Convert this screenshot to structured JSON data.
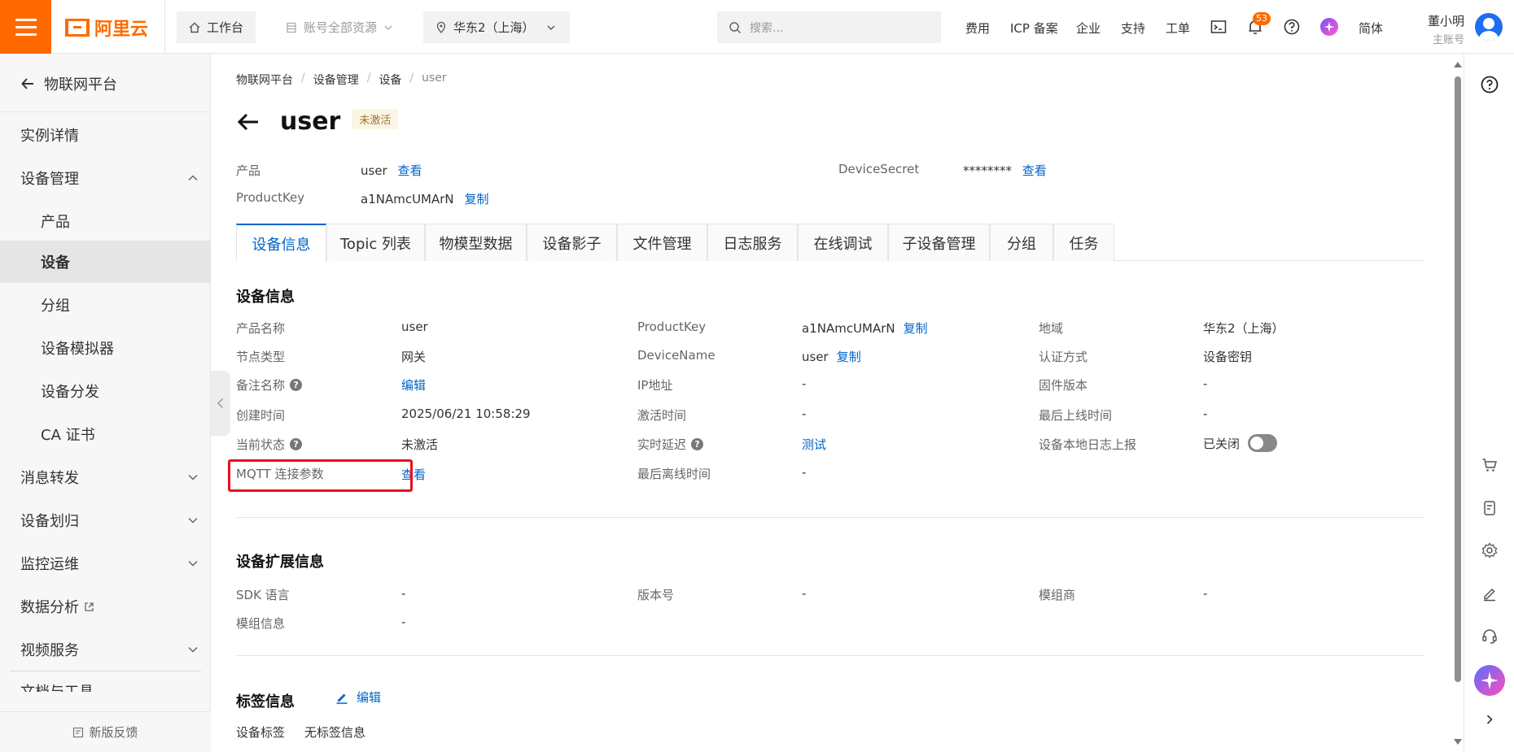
{
  "topbar": {
    "logo_text": "阿里云",
    "workbench": "工作台",
    "resources": "账号全部资源",
    "region": "华东2（上海）",
    "search_placeholder": "搜索...",
    "nav": [
      "费用",
      "ICP 备案",
      "企业",
      "支持",
      "工单"
    ],
    "notification_count": "53",
    "lang": "简体",
    "user_name": "董小明",
    "user_role": "主账号",
    "accent": "#ff6a00"
  },
  "sidebar": {
    "back_label": "物联网平台",
    "items": [
      {
        "label": "实例详情"
      },
      {
        "label": "设备管理"
      },
      {
        "label": "产品"
      },
      {
        "label": "设备"
      },
      {
        "label": "分组"
      },
      {
        "label": "设备模拟器"
      },
      {
        "label": "设备分发"
      },
      {
        "label": "CA 证书"
      },
      {
        "label": "消息转发"
      },
      {
        "label": "设备划归"
      },
      {
        "label": "监控运维"
      },
      {
        "label": "数据分析"
      },
      {
        "label": "视频服务"
      },
      {
        "label": "文档与工具"
      }
    ],
    "feedback": "新版反馈"
  },
  "breadcrumb": [
    "物联网平台",
    "设备管理",
    "设备",
    "user"
  ],
  "sep": "/",
  "page": {
    "title": "user",
    "status_tag": "未激活",
    "product_label": "产品",
    "product_value": "user",
    "product_link": "查看",
    "productkey_label": "ProductKey",
    "productkey_value": "a1NAmcUMArN",
    "productkey_link": "复制",
    "secret_label": "DeviceSecret",
    "secret_value": "********",
    "secret_link": "查看"
  },
  "tabs": [
    "设备信息",
    "Topic 列表",
    "物模型数据",
    "设备影子",
    "文件管理",
    "日志服务",
    "在线调试",
    "子设备管理",
    "分组",
    "任务"
  ],
  "device_info": {
    "title": "设备信息",
    "col1": [
      {
        "label": "产品名称",
        "value": "user"
      },
      {
        "label": "节点类型",
        "value": "网关"
      },
      {
        "label": "备注名称",
        "value": "编辑"
      },
      {
        "label": "创建时间",
        "value": "2025/06/21 10:58:29"
      },
      {
        "label": "当前状态",
        "value": "未激活"
      },
      {
        "label": "MQTT 连接参数",
        "value": "查看"
      }
    ],
    "col2": [
      {
        "label": "ProductKey",
        "value": "a1NAmcUMArN",
        "link": "复制"
      },
      {
        "label": "DeviceName",
        "value": "user",
        "link": "复制"
      },
      {
        "label": "IP地址",
        "value": "-"
      },
      {
        "label": "激活时间",
        "value": "-"
      },
      {
        "label": "实时延迟",
        "value": "测试"
      },
      {
        "label": "最后离线时间",
        "value": "-"
      }
    ],
    "col3": [
      {
        "label": "地域",
        "value": "华东2（上海）"
      },
      {
        "label": "认证方式",
        "value": "设备密钥"
      },
      {
        "label": "固件版本",
        "value": "-"
      },
      {
        "label": "最后上线时间",
        "value": "-"
      },
      {
        "label": "设备本地日志上报",
        "value": "已关闭"
      }
    ],
    "help_glyph": "?"
  },
  "ext_info": {
    "title": "设备扩展信息",
    "rows": [
      {
        "label": "SDK 语言",
        "value": "-"
      },
      {
        "label": "版本号",
        "value": "-"
      },
      {
        "label": "模组商",
        "value": "-"
      },
      {
        "label": "模组信息",
        "value": "-"
      }
    ]
  },
  "tag_info": {
    "title": "标签信息",
    "edit": "编辑",
    "label": "设备标签",
    "value": "无标签信息"
  }
}
